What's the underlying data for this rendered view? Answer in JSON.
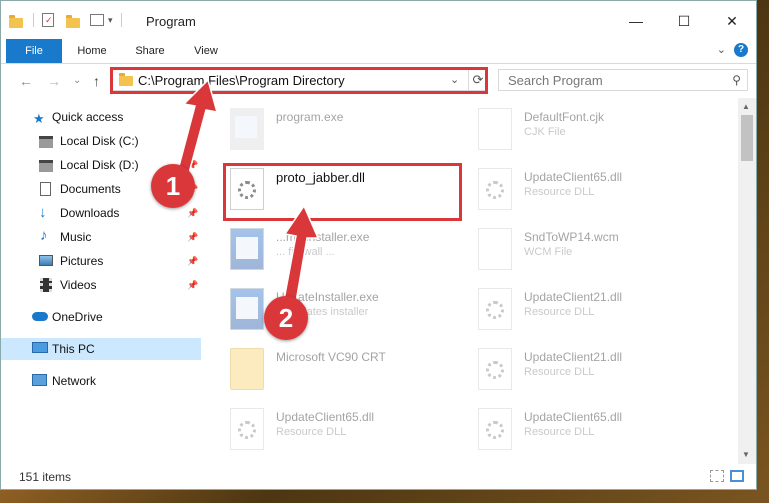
{
  "window": {
    "title": "Program",
    "controls": {
      "minimize": "—",
      "maximize": "☐",
      "close": "✕"
    }
  },
  "ribbon": {
    "tabs": [
      {
        "label": "File"
      },
      {
        "label": "Home"
      },
      {
        "label": "Share"
      },
      {
        "label": "View"
      }
    ],
    "help": "?",
    "collapse": "⌄"
  },
  "nav": {
    "back": "←",
    "forward": "→",
    "recent": "⌄",
    "up": "↑",
    "address": "C:\\Program Files\\Program Directory",
    "address_chevron": "⌄",
    "refresh": "⟳",
    "search_placeholder": "Search Program",
    "search_icon": "⚲"
  },
  "sidebar": {
    "items": [
      {
        "label": "Quick access",
        "icon": "star-icon",
        "pinned": false
      },
      {
        "label": "Local Disk (C:)",
        "icon": "drive-icon",
        "pinned": true
      },
      {
        "label": "Local Disk (D:)",
        "icon": "drive-icon",
        "pinned": true
      },
      {
        "label": "Documents",
        "icon": "documents-icon",
        "pinned": true
      },
      {
        "label": "Downloads",
        "icon": "downloads-icon",
        "pinned": true
      },
      {
        "label": "Music",
        "icon": "music-icon",
        "pinned": true
      },
      {
        "label": "Pictures",
        "icon": "pictures-icon",
        "pinned": true
      },
      {
        "label": "Videos",
        "icon": "videos-icon",
        "pinned": true
      },
      {
        "label": "OneDrive",
        "icon": "cloud-icon",
        "pinned": false
      },
      {
        "label": "This PC",
        "icon": "computer-icon",
        "pinned": false,
        "selected": true
      },
      {
        "label": "Network",
        "icon": "network-icon",
        "pinned": false
      }
    ],
    "pin_glyph": "📌"
  },
  "files": {
    "left": [
      {
        "name": "program.exe",
        "desc": "",
        "type": "app"
      },
      {
        "name": "proto_jabber.dll",
        "desc": "",
        "type": "dll"
      },
      {
        "name": "...mminstaller.exe",
        "desc": "... firewall ...",
        "type": "app"
      },
      {
        "name": "UpdateInstaller.exe",
        "desc": "... updates installer",
        "type": "app"
      },
      {
        "name": "Microsoft VC90 CRT",
        "desc": "",
        "type": "folder"
      },
      {
        "name": "UpdateClient65.dll",
        "desc": "Resource DLL",
        "type": "dll"
      }
    ],
    "right": [
      {
        "name": "DefaultFont.cjk",
        "desc": "CJK File",
        "type": "blank"
      },
      {
        "name": "UpdateClient65.dll",
        "desc": "Resource DLL",
        "type": "dll"
      },
      {
        "name": "SndToWP14.wcm",
        "desc": "WCM File",
        "type": "blank"
      },
      {
        "name": "UpdateClient21.dll",
        "desc": "Resource DLL",
        "type": "dll"
      },
      {
        "name": "UpdateClient21.dll",
        "desc": "Resource DLL",
        "type": "dll"
      },
      {
        "name": "UpdateClient65.dll",
        "desc": "Resource DLL",
        "type": "dll"
      }
    ]
  },
  "status": {
    "count": "151 items"
  },
  "annotations": {
    "badge1": "1",
    "badge2": "2"
  },
  "colors": {
    "accent": "#1979ca",
    "highlight": "#d9373a",
    "selected": "#cce8ff"
  }
}
